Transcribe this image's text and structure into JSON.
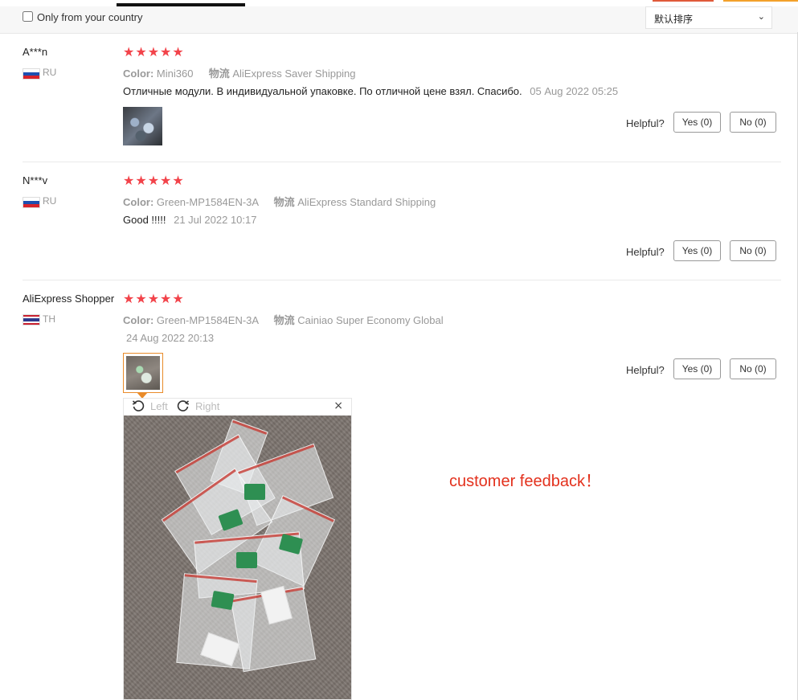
{
  "filter": {
    "only_country_label": "Only from your country",
    "only_country_checked": false,
    "sort_label": "默认排序"
  },
  "reviews": [
    {
      "user": "A***n",
      "country": "RU",
      "stars": "★★★★★",
      "color_key": "Color:",
      "color_value": "Mini360",
      "shipping_key": "物流",
      "shipping_value": "AliExpress Saver Shipping",
      "text": "Отличные модули. В индивидуальной упаковке. По отличной цене взял. Спасибо.",
      "date": "05 Aug 2022 05:25",
      "helpful_label": "Helpful?",
      "yes_label": "Yes (0)",
      "no_label": "No (0)"
    },
    {
      "user": "N***v",
      "country": "RU",
      "stars": "★★★★★",
      "color_key": "Color:",
      "color_value": "Green-MP1584EN-3A",
      "shipping_key": "物流",
      "shipping_value": "AliExpress Standard Shipping",
      "text": "Good !!!!!",
      "date": "21 Jul 2022 10:17",
      "helpful_label": "Helpful?",
      "yes_label": "Yes (0)",
      "no_label": "No (0)"
    },
    {
      "user": "AliExpress Shopper",
      "country": "TH",
      "stars": "★★★★★",
      "color_key": "Color:",
      "color_value": "Green-MP1584EN-3A",
      "shipping_key": "物流",
      "shipping_value": "Cainiao Super Economy Global",
      "date": "24 Aug 2022 20:13",
      "helpful_label": "Helpful?",
      "yes_label": "Yes (0)",
      "no_label": "No (0)"
    }
  ],
  "viewer": {
    "rotate_left_label": "Left",
    "rotate_right_label": "Right",
    "close_glyph": "×",
    "rotate_left_icon": "rotate-left-icon",
    "rotate_right_icon": "rotate-right-icon"
  },
  "annotation": "customer feedback！",
  "colors": {
    "star": "#f2434a",
    "annotation": "#e3311d",
    "active_thumb_border": "#e98b2a"
  }
}
